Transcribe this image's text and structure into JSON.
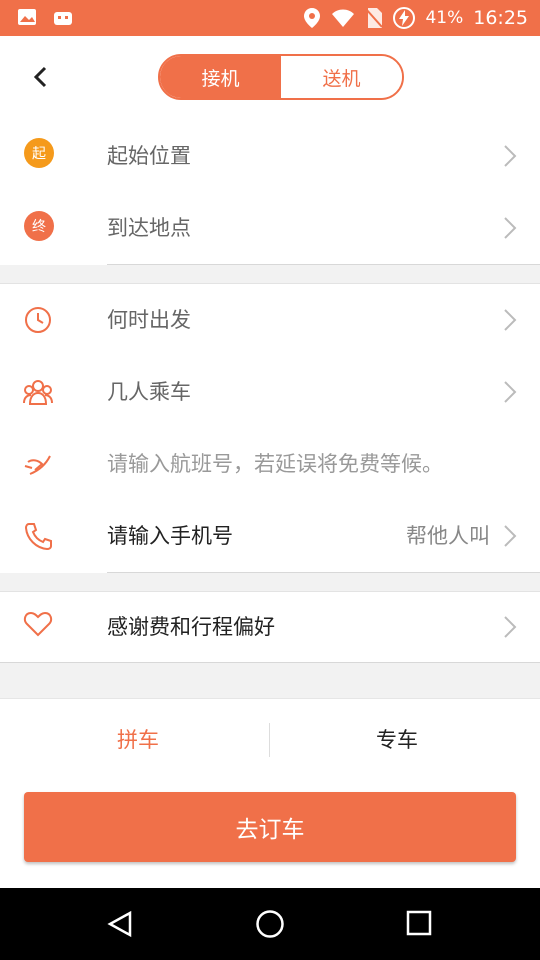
{
  "status_bar": {
    "battery": "41%",
    "time": "16:25"
  },
  "segment": {
    "pickup": "接机",
    "dropoff": "送机"
  },
  "rows": {
    "start": {
      "badge": "起",
      "label": "起始位置"
    },
    "end": {
      "badge": "终",
      "label": "到达地点"
    },
    "time": {
      "label": "何时出发"
    },
    "people": {
      "label": "几人乘车"
    },
    "flight": {
      "placeholder": "请输入航班号，若延误将免费等候。"
    },
    "phone": {
      "label": "请输入手机号",
      "hint": "帮他人叫"
    },
    "thanks": {
      "label": "感谢费和行程偏好"
    }
  },
  "type_tabs": {
    "carpool": "拼车",
    "private": "专车"
  },
  "order_button": "去订车",
  "colors": {
    "accent": "#f07049",
    "badge_start": "#f59a1b",
    "badge_end": "#f07049"
  }
}
